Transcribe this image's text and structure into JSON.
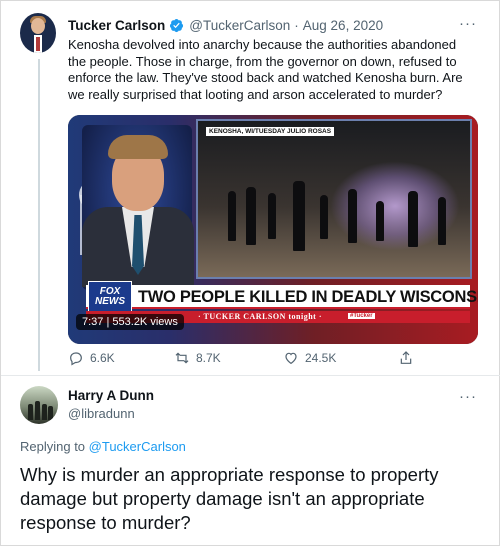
{
  "tweet": {
    "author_name": "Tucker Carlson",
    "author_handle": "@TuckerCarlson",
    "separator": "·",
    "date": "Aug 26, 2020",
    "text": "Kenosha devolved into anarchy because the authorities abandoned the people. Those in charge, from the governor on down, refused to enforce the law. They've stood back and watched Kenosha burn. Are we really surprised that looting and arson accelerated to murder?",
    "more_label": "···",
    "verified_icon": "verified-badge-icon",
    "media": {
      "location_label": "KENOSHA, WI/TUESDAY JULIO ROSAS",
      "network_logo": "FOX NEWS",
      "headline": "TWO PEOPLE KILLED IN DEADLY WISCONSIN RIOTS",
      "subtitle": "· TUCKER CARLSON tonight ·",
      "hashtag": "#Tucker",
      "duration": "7:37",
      "views": "553.2K views"
    },
    "actions": {
      "replies": "6.6K",
      "retweets": "8.7K",
      "likes": "24.5K"
    }
  },
  "reply": {
    "author_name": "Harry A Dunn",
    "author_handle": "@libradunn",
    "more_label": "···",
    "replying_prefix": "Replying to",
    "replying_to": "@TuckerCarlson",
    "text": "Why is murder an appropriate response to property damage but property damage isn't an appropriate response to murder?"
  },
  "colors": {
    "accent": "#1d9bf0",
    "secondary_text": "#536471",
    "fox_red": "#c81e2c"
  }
}
